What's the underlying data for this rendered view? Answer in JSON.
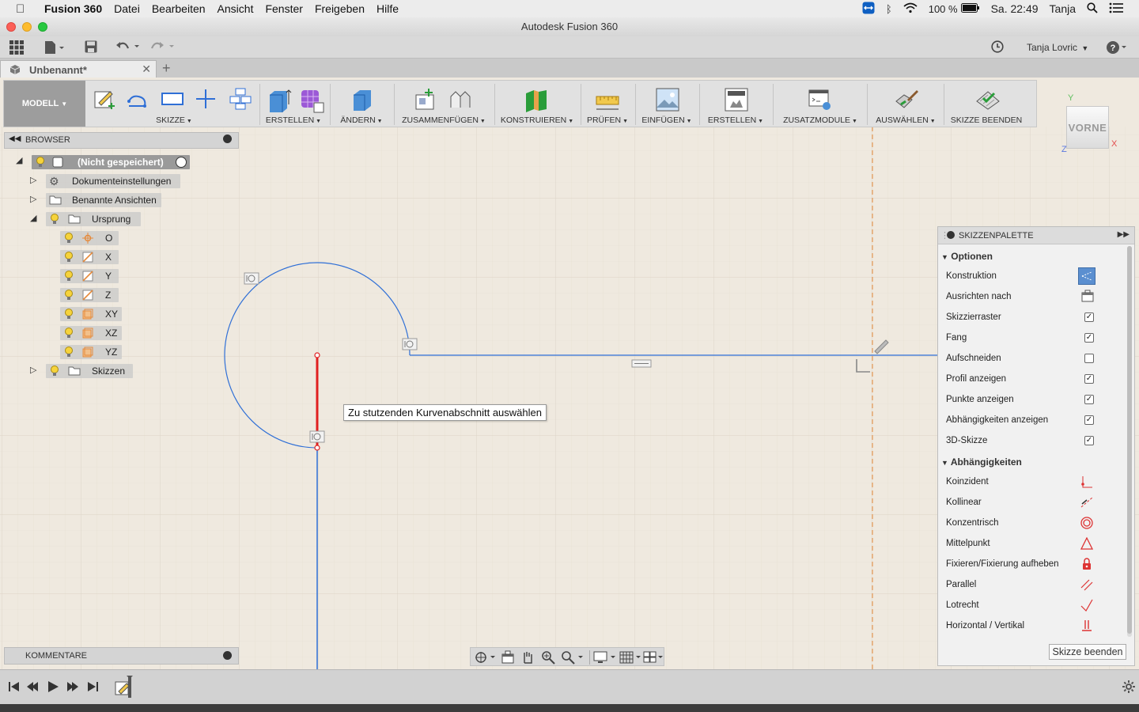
{
  "os_menubar": {
    "app_name": "Fusion 360",
    "items": [
      "Datei",
      "Bearbeiten",
      "Ansicht",
      "Fenster",
      "Freigeben",
      "Hilfe"
    ],
    "battery": "100 %",
    "clock": "Sa. 22:49",
    "user": "Tanja"
  },
  "window": {
    "title": "Autodesk Fusion 360"
  },
  "account": {
    "name": "Tanja Lovric"
  },
  "document_tab": {
    "label": "Unbenannt*"
  },
  "workspace": {
    "label": "MODELL"
  },
  "ribbon": {
    "groups": [
      "SKIZZE",
      "ERSTELLEN",
      "ÄNDERN",
      "ZUSAMMENFÜGEN",
      "KONSTRUIEREN",
      "PRÜFEN",
      "EINFÜGEN",
      "ERSTELLEN",
      "ZUSATZMODULE",
      "AUSWÄHLEN",
      "SKIZZE BEENDEN"
    ]
  },
  "browser": {
    "title": "BROWSER",
    "root": "(Nicht gespeichert)",
    "items": {
      "doc_settings": "Dokumenteinstellungen",
      "named_views": "Benannte Ansichten",
      "origin": "Ursprung",
      "o": "O",
      "x": "X",
      "y": "Y",
      "z": "Z",
      "xy": "XY",
      "xz": "XZ",
      "yz": "YZ",
      "sketches": "Skizzen"
    }
  },
  "comments": {
    "title": "KOMMENTARE"
  },
  "tooltip": {
    "text": "Zu stutzenden Kurvenabschnitt auswählen"
  },
  "viewcube": {
    "face": "VORNE",
    "axis_y": "Y",
    "axis_x": "X",
    "axis_z": "Z"
  },
  "palette": {
    "title": "SKIZZENPALETTE",
    "options_header": "Optionen",
    "options": [
      {
        "label": "Konstruktion",
        "control": "button-active"
      },
      {
        "label": "Ausrichten nach",
        "control": "button"
      },
      {
        "label": "Skizzierraster",
        "checked": true
      },
      {
        "label": "Fang",
        "checked": true
      },
      {
        "label": "Aufschneiden",
        "checked": false
      },
      {
        "label": "Profil anzeigen",
        "checked": true
      },
      {
        "label": "Punkte anzeigen",
        "checked": true
      },
      {
        "label": "Abhängigkeiten anzeigen",
        "checked": true
      },
      {
        "label": "3D-Skizze",
        "checked": true
      }
    ],
    "constraints_header": "Abhängigkeiten",
    "constraints": [
      {
        "label": "Koinzident",
        "icon": "coincident-icon"
      },
      {
        "label": "Kollinear",
        "icon": "collinear-icon"
      },
      {
        "label": "Konzentrisch",
        "icon": "concentric-icon"
      },
      {
        "label": "Mittelpunkt",
        "icon": "midpoint-icon"
      },
      {
        "label": "Fixieren/Fixierung aufheben",
        "icon": "lock-icon"
      },
      {
        "label": "Parallel",
        "icon": "parallel-icon"
      },
      {
        "label": "Lotrecht",
        "icon": "perpendicular-icon"
      },
      {
        "label": "Horizontal / Vertikal",
        "icon": "horizontal-vertical-icon"
      }
    ],
    "finish_button": "Skizze beenden"
  },
  "colors": {
    "sketch_blue": "#2f6fd6",
    "selected_red": "#e02020",
    "canvas_bg": "#efe9df",
    "grid": "#e3dccf",
    "origin_axis": "#e58a3c"
  }
}
